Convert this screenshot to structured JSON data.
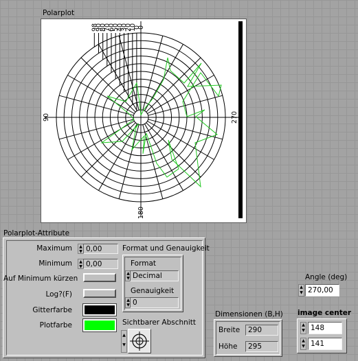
{
  "polarplot": {
    "title": "Polarplot",
    "angle_labels": {
      "top": "0",
      "left": "90",
      "bottom": "180",
      "right": "270"
    },
    "ring_labels": [
      "98",
      "90",
      "80",
      "70",
      "60",
      "50",
      "40",
      "30",
      "20",
      "10",
      "0"
    ],
    "plot_color": "#00d000",
    "grid_color": "#000000"
  },
  "attributes": {
    "title": "Polarplot-Attribute",
    "maximum_label": "Maximum",
    "maximum_value": "0,00",
    "minimum_label": "Minimum",
    "minimum_value": "0,00",
    "truncate_label": "Auf Minimum kürzen",
    "log_label": "Log?(F)",
    "grid_color_label": "Gitterfarbe",
    "grid_color": "#000000",
    "plot_color_label": "Plotfarbe",
    "plot_color": "#00ff00",
    "format_title": "Format und Genauigkeit",
    "format_label": "Format",
    "format_value": "Decimal",
    "precision_label": "Genauigkeit",
    "precision_value": "0",
    "visible_section_label": "Sichtbarer Abschnitt"
  },
  "dimensions": {
    "title": "Dimensionen (B,H)",
    "width_label": "Breite",
    "width_value": "290",
    "height_label": "Höhe",
    "height_value": "295"
  },
  "angle": {
    "label": "Angle (deg)",
    "value": "270,00"
  },
  "image_center": {
    "label": "image center",
    "x_value": "148",
    "y_value": "141"
  }
}
